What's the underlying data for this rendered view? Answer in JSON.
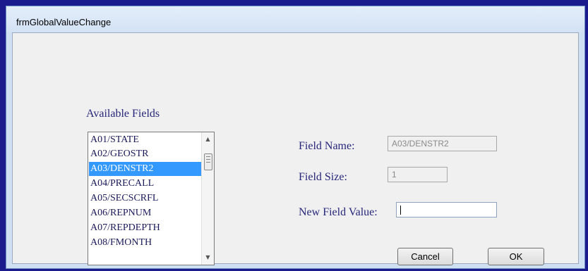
{
  "window": {
    "title": "frmGlobalValueChange"
  },
  "available_fields": {
    "label": "Available Fields",
    "items": [
      "A01/STATE",
      "A02/GEOSTR",
      "A03/DENSTR2",
      "A04/PRECALL",
      "A05/SECSCRFL",
      "A06/REPNUM",
      "A07/REPDEPTH",
      "A08/FMONTH"
    ],
    "selected": "A03/DENSTR2"
  },
  "field_name": {
    "label": "Field Name:",
    "value": "A03/DENSTR2"
  },
  "field_size": {
    "label": "Field Size:",
    "value": "1"
  },
  "new_field_value": {
    "label": "New Field Value:",
    "value": ""
  },
  "buttons": {
    "cancel": "Cancel",
    "ok": "OK"
  },
  "icons": {
    "scroll_up": "scroll-up-arrow",
    "scroll_down": "scroll-down-arrow"
  }
}
